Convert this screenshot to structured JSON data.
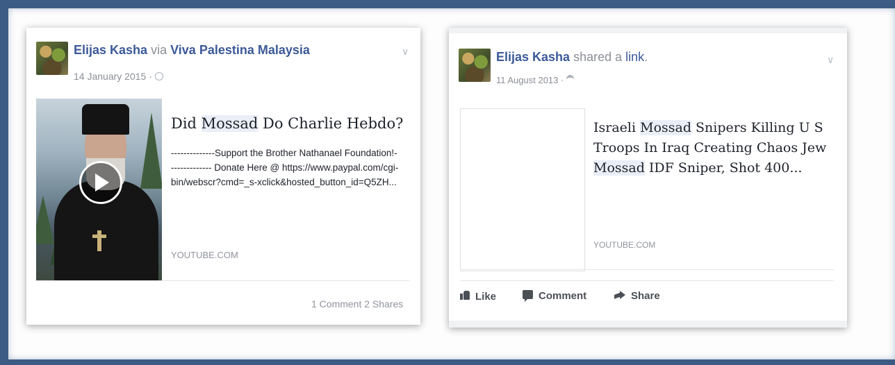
{
  "post_left": {
    "author": "Elijas Kasha",
    "via_word": "via",
    "page_name": "Viva Palestina Malaysia",
    "date": "14 January 2015 ·",
    "privacy_icon": "globe-icon",
    "chevron_icon": "chevron-down-icon",
    "link_title_pre": "Did ",
    "link_title_hl": "Mossad",
    "link_title_post": " Do Charlie Hebdo?",
    "description": "--------------Support the Brother Nathanael Foundation!-------------- Donate Here @ https://www.paypal.com/cgi-bin/webscr?cmd=_s-xclick&hosted_button_id=Q5ZH...",
    "domain": "YOUTUBE.COM",
    "counts": "1 Comment  2 Shares",
    "video_icon": "play-icon"
  },
  "post_right": {
    "author": "Elijas Kasha",
    "shared_text": "shared a",
    "link_word": "link",
    "date": "11 August 2013 ·",
    "privacy_icon": "friends-icon",
    "chevron_icon": "chevron-down-icon",
    "title_line1_pre": "Israeli ",
    "title_line1_hl": "Mossad",
    "title_line1_post": " Snipers Killing U S",
    "title_line2": "Troops In Iraq Creating Chaos Jew",
    "title_line3_hl": "Mossad",
    "title_line3_post": " IDF Sniper, Shot 400...",
    "domain": "YOUTUBE.COM",
    "actions": {
      "like": "Like",
      "comment": "Comment",
      "share": "Share"
    }
  },
  "colors": {
    "frame": "#3c5c86",
    "link_blue": "#3b5998",
    "muted": "#90949c"
  }
}
